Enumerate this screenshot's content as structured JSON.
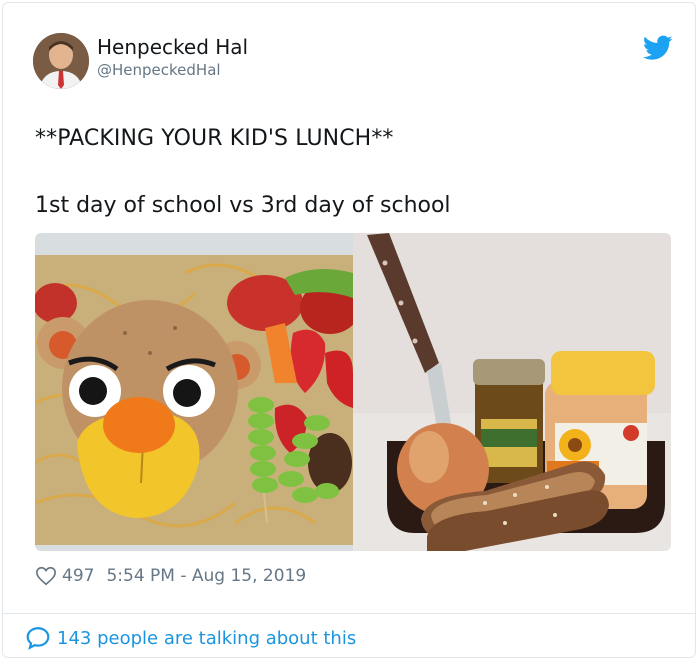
{
  "tweet": {
    "author_name": "Henpecked Hal",
    "author_handle": "@HenpeckedHal",
    "line1": "**PACKING YOUR KID'S LUNCH**",
    "line2": "1st day of school vs 3rd day of school",
    "likes": "497",
    "timestamp": "5:54 PM - Aug 15, 2019",
    "conversation": "143 people are talking about this"
  },
  "icons": {
    "brand": "twitter-bird-icon",
    "like": "heart-icon",
    "reply": "speech-bubble-icon"
  },
  "colors": {
    "accent": "#1da1f2",
    "link": "#1b95e0",
    "muted": "#657786"
  }
}
